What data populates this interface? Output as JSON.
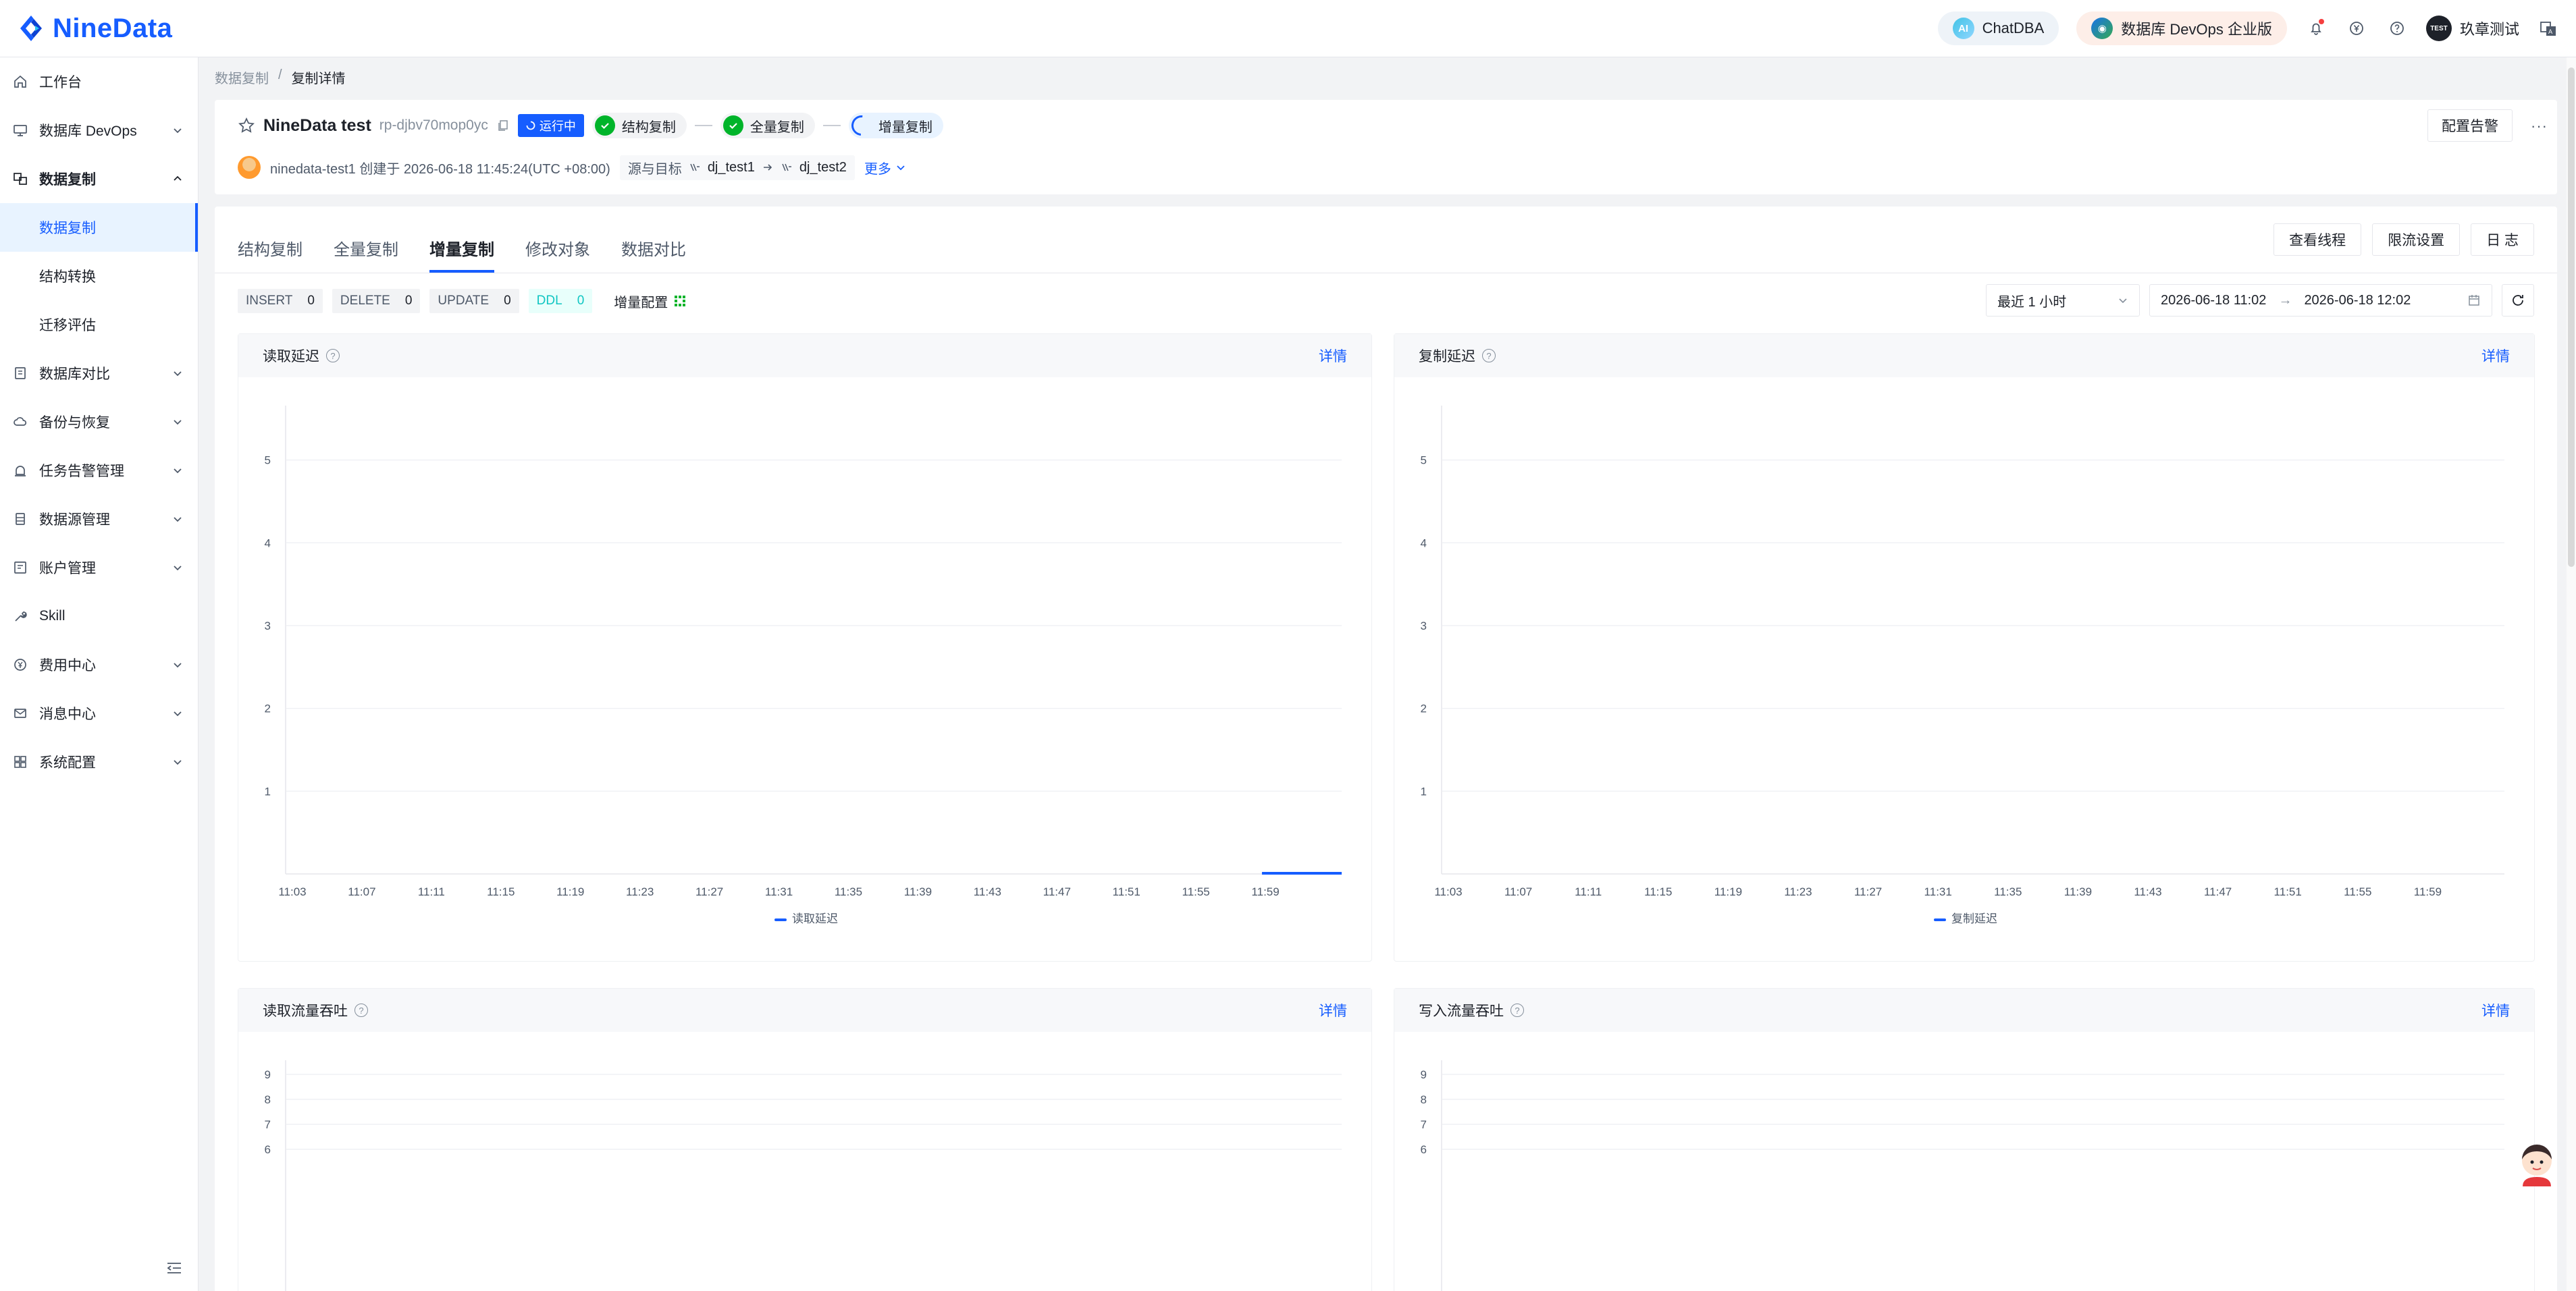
{
  "topbar": {
    "logo_text": "NineData",
    "chatdba_label": "ChatDBA",
    "devops_label": "数据库 DevOps 企业版",
    "user_badge": "TEST",
    "user_name": "玖章测试"
  },
  "sidebar": {
    "items": [
      {
        "label": "工作台",
        "icon": "home-icon"
      },
      {
        "label": "数据库 DevOps",
        "icon": "monitor-icon"
      },
      {
        "label": "数据复制",
        "icon": "replicate-icon"
      },
      {
        "label": "数据复制",
        "icon": ""
      },
      {
        "label": "结构转换",
        "icon": ""
      },
      {
        "label": "迁移评估",
        "icon": ""
      },
      {
        "label": "数据库对比",
        "icon": "compare-icon"
      },
      {
        "label": "备份与恢复",
        "icon": "cloud-icon"
      },
      {
        "label": "任务告警管理",
        "icon": "alarm-icon"
      },
      {
        "label": "数据源管理",
        "icon": "database-icon"
      },
      {
        "label": "账户管理",
        "icon": "account-icon"
      },
      {
        "label": "Skill",
        "icon": "wrench-icon"
      },
      {
        "label": "费用中心",
        "icon": "yen-icon"
      },
      {
        "label": "消息中心",
        "icon": "mail-icon"
      },
      {
        "label": "系统配置",
        "icon": "grid-icon"
      }
    ]
  },
  "breadcrumb": {
    "parent": "数据复制",
    "separator": "/",
    "current": "复制详情"
  },
  "task": {
    "name": "NineData test",
    "id": "rp-djbv70mop0yc",
    "status": "运行中",
    "stages": [
      "结构复制",
      "全量复制",
      "增量复制"
    ],
    "creator_line": "ninedata-test1 创建于 2026-06-18 11:45:24(UTC +08:00)",
    "src_dst_label": "源与目标",
    "source": "dj_test1",
    "target": "dj_test2",
    "more": "更多",
    "alert_button": "配置告警",
    "dots": "···"
  },
  "tabs": [
    "结构复制",
    "全量复制",
    "增量复制",
    "修改对象",
    "数据对比"
  ],
  "active_tab": "增量复制",
  "tab_buttons": [
    "查看线程",
    "限流设置",
    "日 志"
  ],
  "counters": [
    {
      "label": "INSERT",
      "value": "0"
    },
    {
      "label": "DELETE",
      "value": "0"
    },
    {
      "label": "UPDATE",
      "value": "0"
    },
    {
      "label": "DDL",
      "value": "0"
    }
  ],
  "incr_config": "增量配置",
  "time": {
    "preset": "最近 1 小时",
    "start": "2026-06-18 11:02",
    "arrow": "→",
    "end": "2026-06-18 12:02"
  },
  "detail_label": "详情",
  "colors": {
    "accent": "#165dff",
    "success": "#00b42a",
    "ddl": "#0fc6c2"
  },
  "chart_data": [
    {
      "type": "line",
      "title": "读取延迟",
      "x": [
        "11:03",
        "11:07",
        "11:11",
        "11:15",
        "11:19",
        "11:23",
        "11:27",
        "11:31",
        "11:35",
        "11:39",
        "11:43",
        "11:47",
        "11:51",
        "11:55",
        "11:59"
      ],
      "yticks": [
        1,
        2,
        3,
        4,
        5
      ],
      "ylim": [
        0,
        6
      ],
      "series": [
        {
          "name": "读取延迟",
          "values": [
            null,
            null,
            null,
            null,
            null,
            null,
            null,
            null,
            null,
            null,
            null,
            null,
            null,
            null,
            0
          ],
          "tail": [
            0,
            0
          ]
        }
      ],
      "legend": "bottom-center"
    },
    {
      "type": "line",
      "title": "复制延迟",
      "x": [
        "11:03",
        "11:07",
        "11:11",
        "11:15",
        "11:19",
        "11:23",
        "11:27",
        "11:31",
        "11:35",
        "11:39",
        "11:43",
        "11:47",
        "11:51",
        "11:55",
        "11:59"
      ],
      "yticks": [
        1,
        2,
        3,
        4,
        5
      ],
      "ylim": [
        0,
        6
      ],
      "series": [
        {
          "name": "复制延迟",
          "values": []
        }
      ],
      "legend": "bottom-center"
    },
    {
      "type": "line",
      "title": "读取流量吞吐",
      "yticks": [
        6,
        7,
        8,
        9
      ],
      "ylim": [
        0,
        10
      ],
      "series": []
    },
    {
      "type": "line",
      "title": "写入流量吞吐",
      "yticks": [
        6,
        7,
        8,
        9
      ],
      "ylim": [
        0,
        10
      ],
      "series": []
    }
  ]
}
